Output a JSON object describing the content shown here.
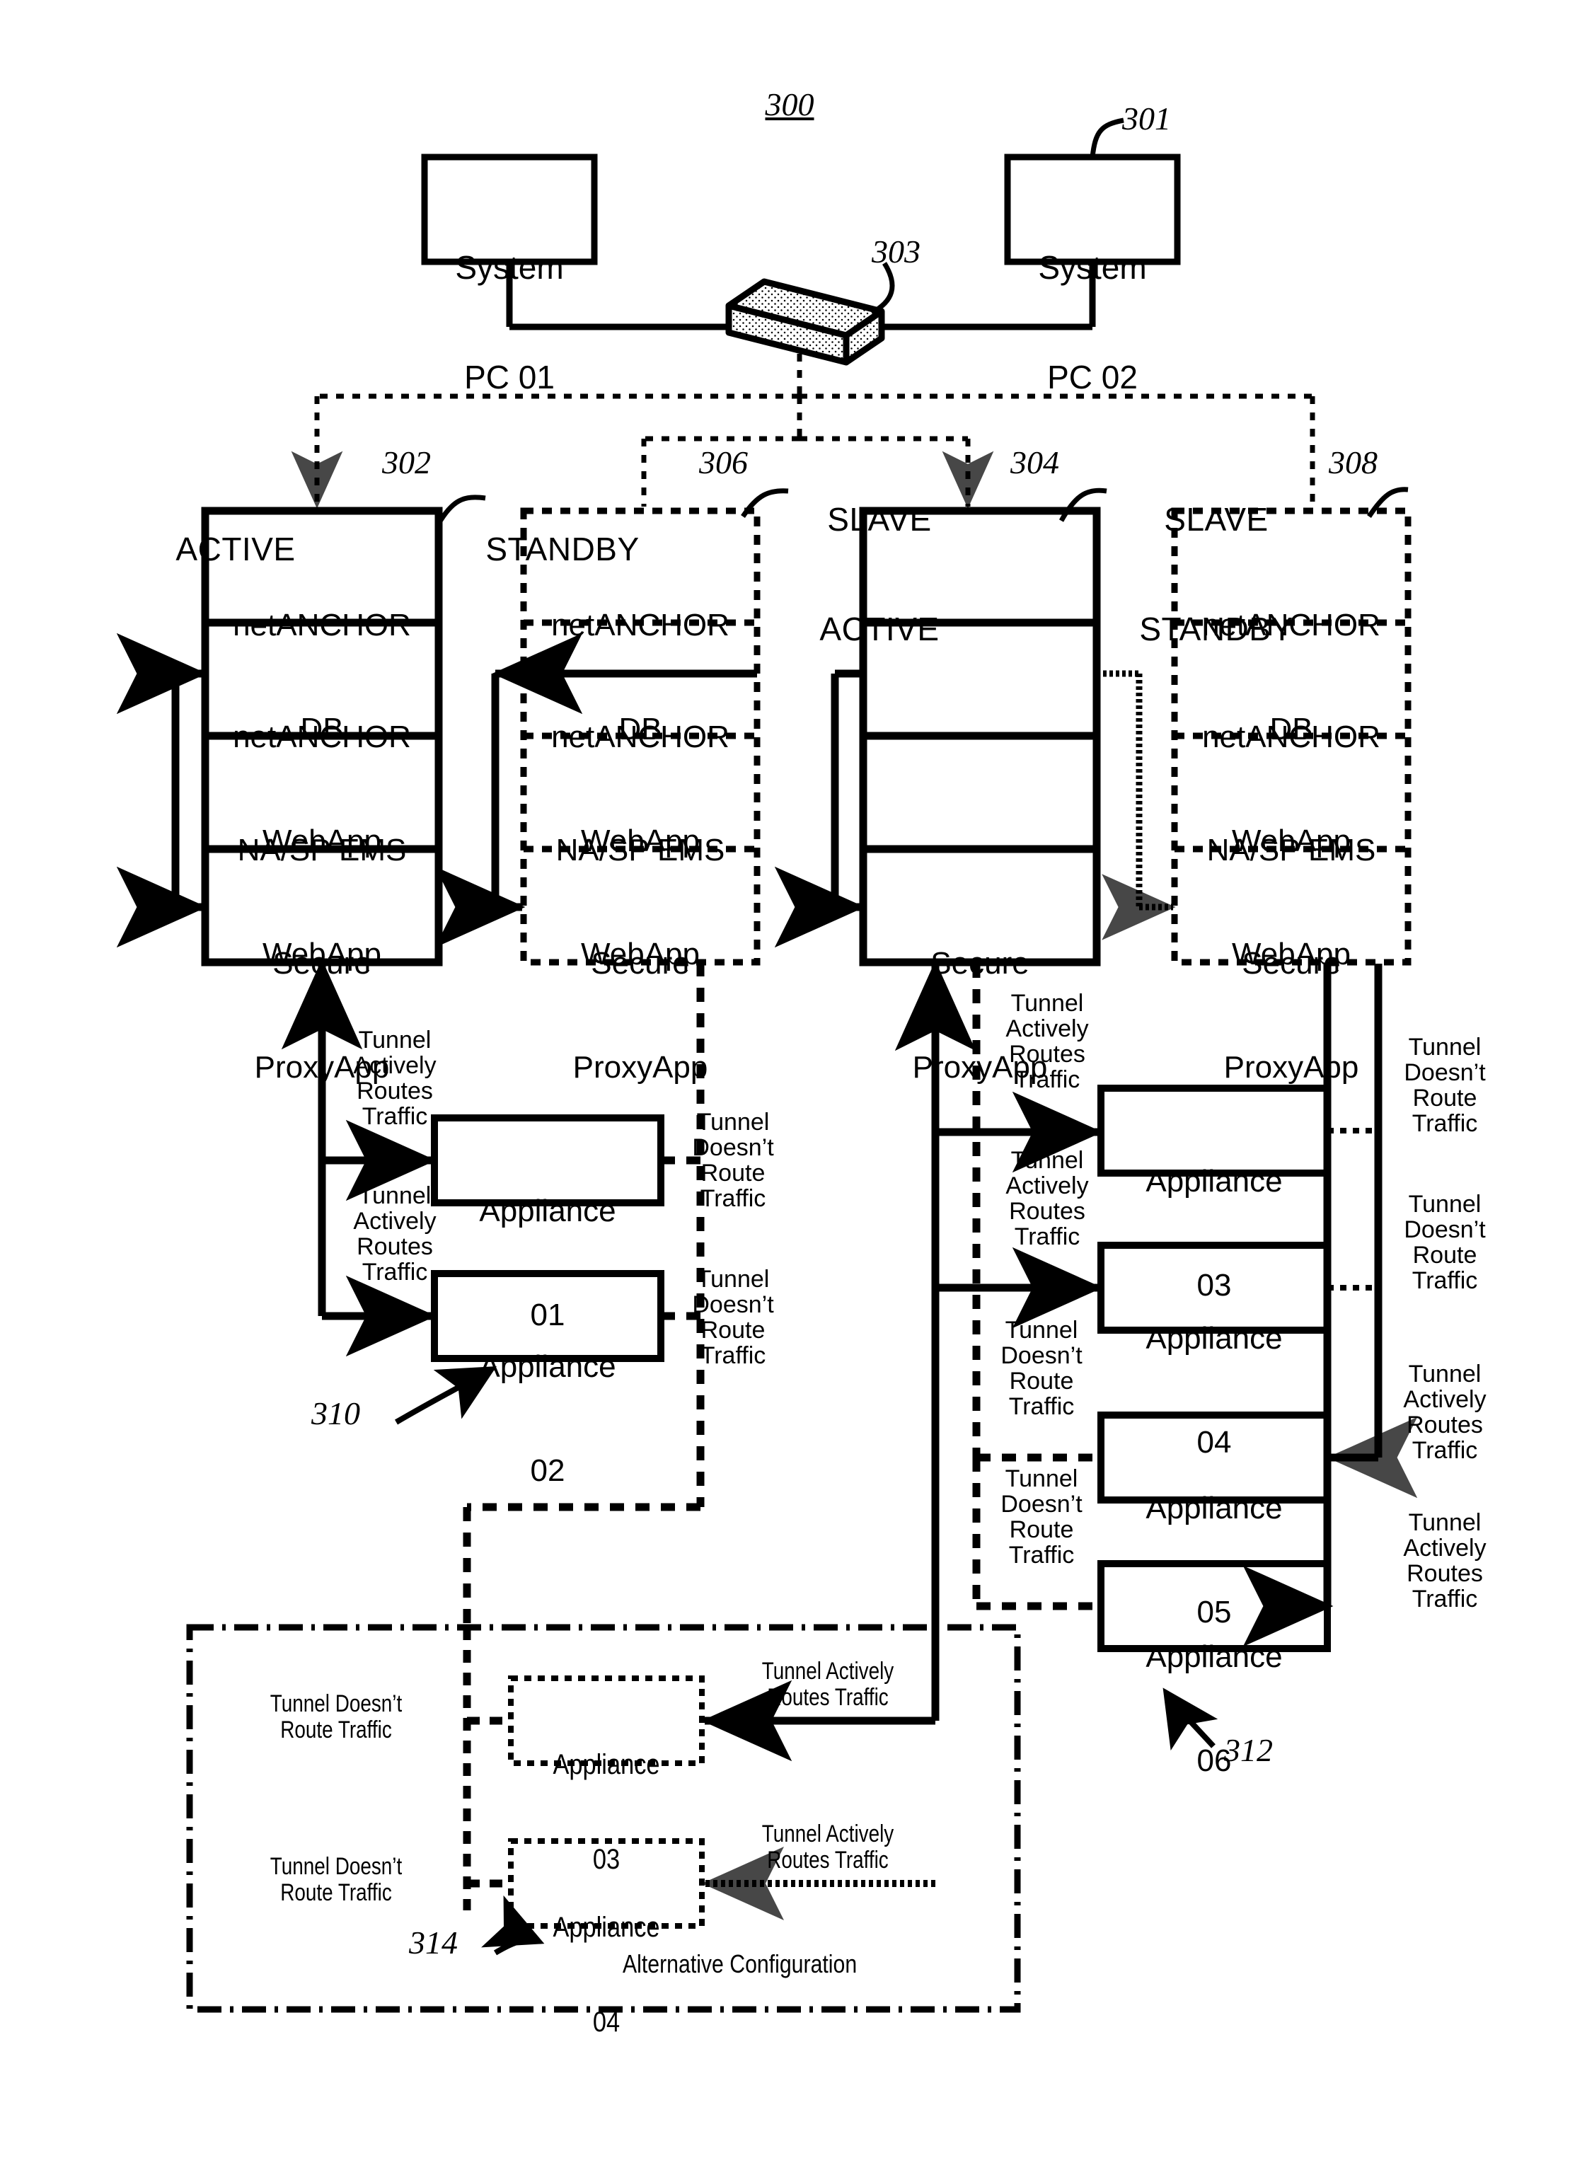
{
  "figure": {
    "number": "300",
    "reference_numerals": {
      "system_pc": "301",
      "active_server": "302",
      "network_bus": "303",
      "slave_active_server": "304",
      "standby_server": "306",
      "slave_standby_server": "308",
      "appliance_group_left": "310",
      "appliance_group_right": "312",
      "appliance_group_alternative": "314"
    }
  },
  "hosts": [
    {
      "id": "pc01",
      "line1": "System",
      "line2": "PC 01"
    },
    {
      "id": "pc02",
      "line1": "System",
      "line2": "PC 02"
    }
  ],
  "columns": [
    {
      "id": "active",
      "header": "ACTIVE",
      "header_lines": [
        "ACTIVE"
      ],
      "ref": "302",
      "border": "solid",
      "cells": [
        {
          "line1": "netANCHOR",
          "line2": "DB"
        },
        {
          "line1": "netANCHOR",
          "line2": "WebApp"
        },
        {
          "line1": "NA/SP EMS",
          "line2": "WebApp"
        },
        {
          "line1": "Secure",
          "line2": "ProxyApp"
        }
      ]
    },
    {
      "id": "standby",
      "header": "STANDBY",
      "header_lines": [
        "STANDBY"
      ],
      "ref": "306",
      "border": "dashed",
      "cells": [
        {
          "line1": "netANCHOR",
          "line2": "DB"
        },
        {
          "line1": "netANCHOR",
          "line2": "WebApp"
        },
        {
          "line1": "NA/SP EMS",
          "line2": "WebApp"
        },
        {
          "line1": "Secure",
          "line2": "ProxyApp"
        }
      ]
    },
    {
      "id": "slave-active",
      "header": "SLAVE ACTIVE",
      "header_lines": [
        "SLAVE",
        "ACTIVE"
      ],
      "ref": "304",
      "border": "solid",
      "cells": [
        {
          "line1": "",
          "line2": ""
        },
        {
          "line1": "",
          "line2": ""
        },
        {
          "line1": "",
          "line2": ""
        },
        {
          "line1": "Secure",
          "line2": "ProxyApp"
        }
      ]
    },
    {
      "id": "slave-standby",
      "header": "SLAVE STANDBY",
      "header_lines": [
        "SLAVE",
        "STANDBY"
      ],
      "ref": "308",
      "border": "dashed",
      "cells": [
        {
          "line1": "netANCHOR",
          "line2": "DB"
        },
        {
          "line1": "netANCHOR",
          "line2": "WebApp"
        },
        {
          "line1": "NA/SP EMS",
          "line2": "WebApp"
        },
        {
          "line1": "Secure",
          "line2": "ProxyApp"
        }
      ]
    }
  ],
  "appliances_left": [
    {
      "id": "a01",
      "line1": "Appliance",
      "line2": "01"
    },
    {
      "id": "a02",
      "line1": "Appliance",
      "line2": "02"
    }
  ],
  "appliances_right": [
    {
      "id": "a03",
      "line1": "Appliance",
      "line2": "03"
    },
    {
      "id": "a04",
      "line1": "Appliance",
      "line2": "04"
    },
    {
      "id": "a05",
      "line1": "Appliance",
      "line2": "05"
    },
    {
      "id": "a06",
      "line1": "Appliance",
      "line2": "06"
    }
  ],
  "appliances_alternative": [
    {
      "id": "alt03",
      "line1": "Appliance",
      "line2": "03"
    },
    {
      "id": "alt04",
      "line1": "Appliance",
      "line2": "04"
    }
  ],
  "tunnel_labels": {
    "active_stacked": "Tunnel\nActively\nRoutes\nTraffic",
    "inactive_stacked": "Tunnel\nDoesn’t\nRoute\nTraffic",
    "active_wrapped": "Tunnel Actively\nRoutes Traffic",
    "inactive_wrapped": "Tunnel Doesn’t\nRoute Traffic"
  },
  "left_tunnels": [
    {
      "target": "a01",
      "side": "left",
      "text": "Tunnel\nActively\nRoutes\nTraffic"
    },
    {
      "target": "a02",
      "side": "left",
      "text": "Tunnel\nActively\nRoutes\nTraffic"
    },
    {
      "target": "a01",
      "side": "right",
      "text": "Tunnel\nDoesn’t\nRoute\nTraffic"
    },
    {
      "target": "a02",
      "side": "right",
      "text": "Tunnel\nDoesn’t\nRoute\nTraffic"
    }
  ],
  "right_tunnels": [
    {
      "target": "a03",
      "side": "left",
      "text": "Tunnel\nActively\nRoutes\nTraffic"
    },
    {
      "target": "a04",
      "side": "left",
      "text": "Tunnel\nActively\nRoutes\nTraffic"
    },
    {
      "target": "a05",
      "side": "left",
      "text": "Tunnel\nDoesn’t\nRoute\nTraffic"
    },
    {
      "target": "a06",
      "side": "left",
      "text": "Tunnel\nDoesn’t\nRoute\nTraffic"
    },
    {
      "target": "a03",
      "side": "right",
      "text": "Tunnel\nDoesn’t\nRoute\nTraffic"
    },
    {
      "target": "a04",
      "side": "right",
      "text": "Tunnel\nDoesn’t\nRoute\nTraffic"
    },
    {
      "target": "a05",
      "side": "right",
      "text": "Tunnel\nActively\nRoutes\nTraffic"
    },
    {
      "target": "a06",
      "side": "right",
      "text": "Tunnel\nActively\nRoutes\nTraffic"
    }
  ],
  "alternative": {
    "caption": "Alternative Configuration",
    "ref": "314",
    "tunnels": [
      {
        "target": "alt03",
        "side": "left",
        "text": "Tunnel Doesn’t\nRoute Traffic"
      },
      {
        "target": "alt04",
        "side": "left",
        "text": "Tunnel Doesn’t\nRoute Traffic"
      },
      {
        "target": "alt03",
        "side": "right",
        "text": "Tunnel Actively\nRoutes Traffic"
      },
      {
        "target": "alt04",
        "side": "right",
        "text": "Tunnel Actively\nRoutes Traffic"
      }
    ]
  },
  "colors": {
    "ink": "#000000",
    "paper": "#ffffff"
  }
}
